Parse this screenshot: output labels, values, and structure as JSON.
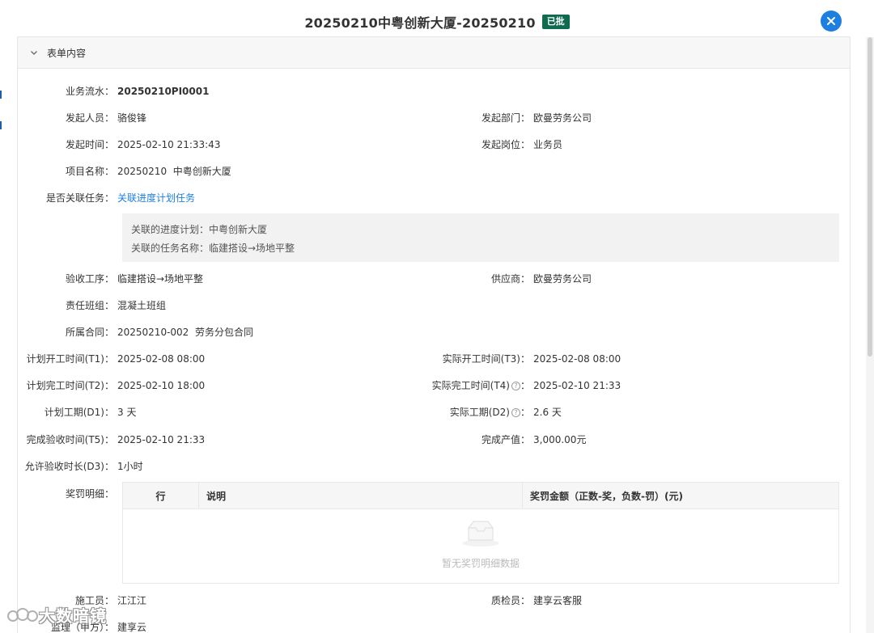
{
  "header": {
    "title": "20250210中粤创新大厦-20250210",
    "status_badge": "已批"
  },
  "panel": {
    "title": "表单内容"
  },
  "fields": {
    "biz_no": {
      "label": "业务流水",
      "value": "20250210PI0001"
    },
    "initiator": {
      "label": "发起人员",
      "value": "骆俊锋"
    },
    "dept": {
      "label": "发起部门",
      "value": "欧曼劳务公司"
    },
    "start_time": {
      "label": "发起时间",
      "value": "2025-02-10 21:33:43"
    },
    "post": {
      "label": "发起岗位",
      "value": "业务员"
    },
    "project": {
      "label": "项目名称",
      "value": "20250210  中粤创新大厦"
    },
    "linked_task": {
      "label": "是否关联任务",
      "value": "关联进度计划任务"
    },
    "linked_plan_line": "关联的进度计划：中粤创新大厦",
    "linked_task_line": "关联的任务名称：临建搭设→场地平整",
    "process": {
      "label": "验收工序",
      "value": "临建搭设→场地平整"
    },
    "supplier": {
      "label": "供应商",
      "value": "欧曼劳务公司"
    },
    "team": {
      "label": "责任班组",
      "value": "混凝土班组"
    },
    "contract": {
      "label": "所属合同",
      "value": "20250210-002  劳务分包合同"
    },
    "plan_start": {
      "label": "计划开工时间(T1)",
      "value": "2025-02-08 08:00"
    },
    "actual_start": {
      "label": "实际开工时间(T3)",
      "value": "2025-02-08 08:00"
    },
    "plan_end": {
      "label": "计划完工时间(T2)",
      "value": "2025-02-10 18:00"
    },
    "actual_end": {
      "label": "实际完工时间(T4)",
      "value": "2025-02-10 21:33"
    },
    "plan_duration": {
      "label": "计划工期(D1)",
      "value": "3 天"
    },
    "actual_duration": {
      "label": "实际工期(D2)",
      "value": "2.6 天"
    },
    "accept_time": {
      "label": "完成验收时间(T5)",
      "value": "2025-02-10 21:33"
    },
    "output_value": {
      "label": "完成产值",
      "value": "3,000.00元"
    },
    "allowed_duration": {
      "label": "允许验收时长(D3)",
      "value": "1小时"
    },
    "reward_detail": {
      "label": "奖罚明细"
    },
    "worker": {
      "label": "施工员",
      "value": "江江江"
    },
    "inspector": {
      "label": "质检员",
      "value": "建享云客服"
    },
    "supervisor": {
      "label": "监理（甲方）",
      "value": "建享云"
    }
  },
  "reward_table": {
    "columns": [
      "行",
      "说明",
      "奖罚金额（正数-奖，负数-罚）(元)"
    ],
    "empty_text": "暂无奖罚明细数据"
  },
  "help_glyph": "?",
  "watermark": "大数暗镜",
  "colors": {
    "accent": "#1d7fe0",
    "badge": "#0e6b4f"
  }
}
